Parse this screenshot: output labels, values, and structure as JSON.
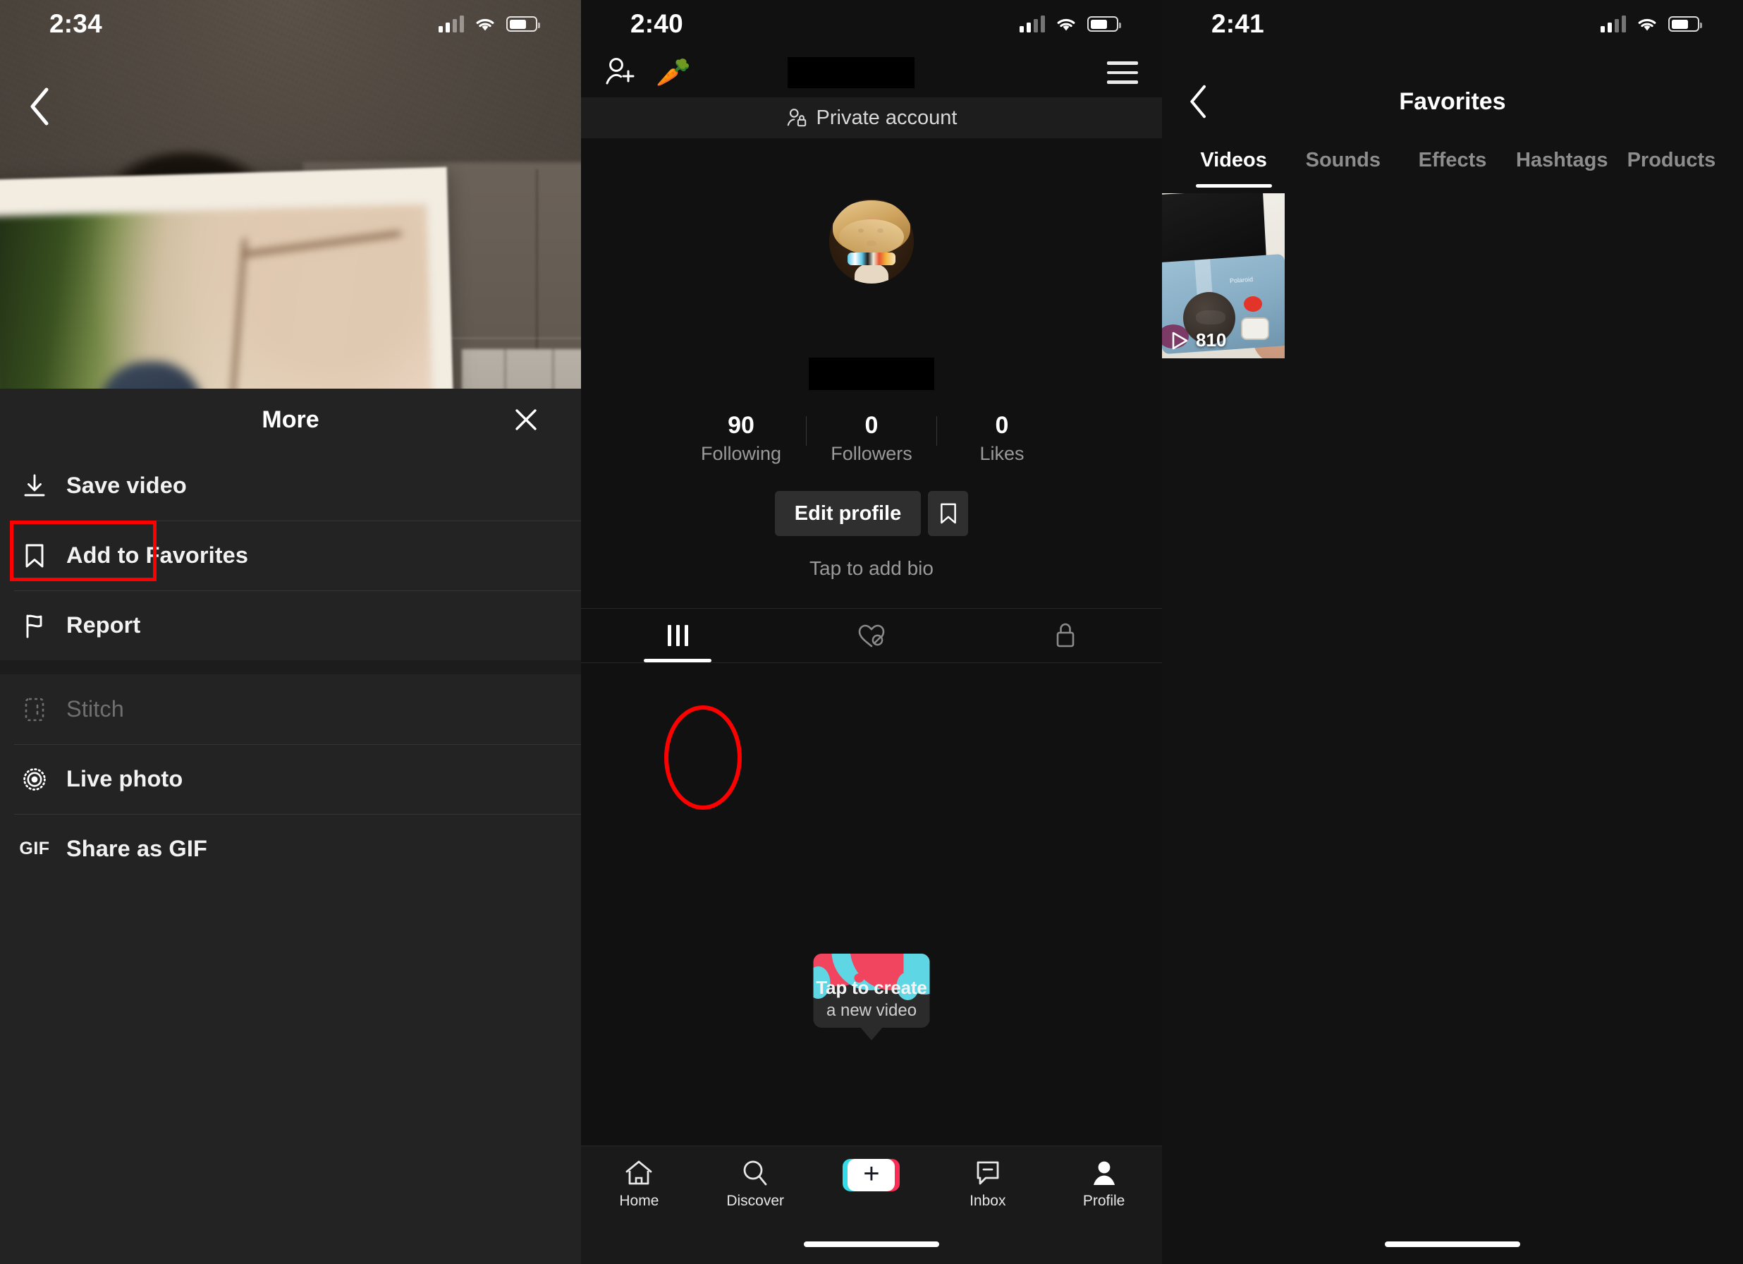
{
  "screens": [
    {
      "id": "video-more-sheet",
      "status_bar": {
        "time": "2:34",
        "cellular_icon": "cellular-signal-icon",
        "wifi_icon": "wifi-icon",
        "battery_icon": "battery-icon"
      },
      "back_icon": "back-chevron-icon",
      "sheet": {
        "title": "More",
        "close_icon": "close-icon",
        "items": [
          {
            "label": "Save video",
            "icon": "download-icon",
            "disabled": false,
            "highlighted": false
          },
          {
            "label": "Add to Favorites",
            "icon": "bookmark-icon",
            "disabled": false,
            "highlighted": true
          },
          {
            "label": "Report",
            "icon": "flag-icon",
            "disabled": false,
            "highlighted": false
          },
          {
            "label": "Stitch",
            "icon": "stitch-icon",
            "disabled": true,
            "highlighted": false
          },
          {
            "label": "Live photo",
            "icon": "live-photo-icon",
            "disabled": false,
            "highlighted": false
          },
          {
            "label": "Share as GIF",
            "icon": "gif-icon",
            "icon_text": "GIF",
            "disabled": false,
            "highlighted": false
          }
        ]
      },
      "highlight_color": "#ff0000"
    },
    {
      "id": "profile",
      "status_bar": {
        "time": "2:40",
        "cellular_icon": "cellular-signal-icon",
        "wifi_icon": "wifi-icon",
        "battery_icon": "battery-icon"
      },
      "top_bar": {
        "add_friends_icon": "add-person-icon",
        "carrot_icon": "carrot-sparkle-icon",
        "username_redacted": "",
        "menu_icon": "hamburger-menu-icon",
        "notification_dot_color": "#fe2c55"
      },
      "private_banner": {
        "icon": "private-person-lock-icon",
        "label": "Private account"
      },
      "avatar_icon": "profile-avatar-dog-with-wig",
      "display_name_redacted": "",
      "stats": [
        {
          "value": "90",
          "label": "Following"
        },
        {
          "value": "0",
          "label": "Followers"
        },
        {
          "value": "0",
          "label": "Likes"
        }
      ],
      "edit_profile_label": "Edit profile",
      "favorites_button_icon": "bookmark-icon",
      "bio_placeholder": "Tap to add bio",
      "content_tabs": [
        {
          "icon": "grid-posts-icon",
          "active": true
        },
        {
          "icon": "liked-hidden-heart-icon",
          "active": false
        },
        {
          "icon": "private-lock-icon",
          "active": false
        }
      ],
      "create_bubble": {
        "line1": "Tap to create",
        "line2": "a new video"
      },
      "nav": [
        {
          "label": "Home",
          "icon": "home-icon"
        },
        {
          "label": "Discover",
          "icon": "search-icon"
        },
        {
          "label": "",
          "icon": "create-plus-button"
        },
        {
          "label": "Inbox",
          "icon": "inbox-message-icon"
        },
        {
          "label": "Profile",
          "icon": "person-icon"
        }
      ],
      "highlight_color": "#ff0000"
    },
    {
      "id": "favorites",
      "status_bar": {
        "time": "2:41",
        "cellular_icon": "cellular-signal-icon",
        "wifi_icon": "wifi-icon",
        "battery_icon": "battery-icon"
      },
      "back_icon": "back-chevron-icon",
      "title": "Favorites",
      "tabs": [
        {
          "label": "Videos",
          "active": true
        },
        {
          "label": "Sounds",
          "active": false
        },
        {
          "label": "Effects",
          "active": false
        },
        {
          "label": "Hashtags",
          "active": false
        },
        {
          "label": "Products",
          "active": false
        }
      ],
      "videos": [
        {
          "play_count": "810",
          "play_icon": "play-icon",
          "thumbnail": "polaroid-now-camera-in-hand"
        }
      ]
    }
  ]
}
